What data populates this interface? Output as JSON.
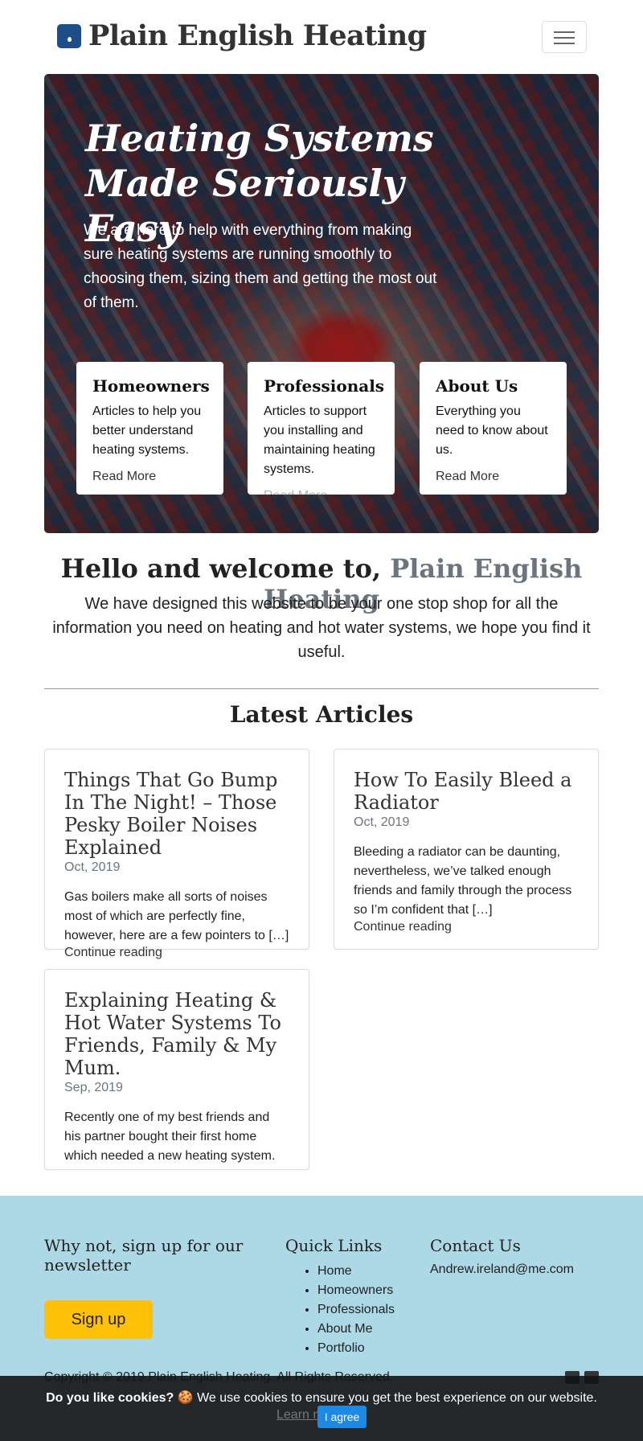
{
  "brand": {
    "name": "Plain English Heating",
    "logo_icon": "water-drop-icon"
  },
  "nav": {
    "menu_icon": "hamburger-icon"
  },
  "hero": {
    "title": "Heating Systems Made Seriously Easy",
    "subtitle": "We are here to help with everything from making sure heating systems are running smoothly to choosing them, sizing them and getting the most out of them.",
    "cards": [
      {
        "title": "Homeowners",
        "text": "Articles to help you better understand heating systems.",
        "link": "Read More"
      },
      {
        "title": "Professionals",
        "text": "Articles to support you installing and maintaining heating systems.",
        "link": "Read More"
      },
      {
        "title": "About Us",
        "text": "Everything you need to know about us.",
        "link": "Read More"
      }
    ]
  },
  "welcome": {
    "title_prefix": "Hello and welcome to,",
    "title_accent": "Plain English Heating",
    "text": "We have designed this website to be your one stop shop for all the information you need on heating and hot water systems, we hope you find it useful."
  },
  "latest": {
    "title": "Latest Articles",
    "articles": [
      {
        "title": "Things That Go Bump In The Night! – Those Pesky Boiler Noises Explained",
        "date": "Oct, 2019",
        "excerpt": "Gas boilers make all sorts of noises most of which are perfectly fine, however, here are a few pointers to […]",
        "link": "Continue reading"
      },
      {
        "title": "How To Easily Bleed a Radiator",
        "date": "Oct, 2019",
        "excerpt": "Bleeding a radiator can be daunting, nevertheless, we’ve talked enough friends and family through the process so I’m confident that […]",
        "link": "Continue reading"
      },
      {
        "title": "Explaining Heating & Hot Water Systems To Friends, Family & My Mum.",
        "date": "Sep, 2019",
        "excerpt": "Recently one of my best friends and his partner bought their first home which needed a new heating system.",
        "link": ""
      }
    ]
  },
  "footer": {
    "newsletter_text": "Why not, sign up for our newsletter",
    "signup_label": "Sign up",
    "quick_links_title": "Quick Links",
    "quick_links": [
      "Home",
      "Homeowners",
      "Professionals",
      "About Me",
      "Portfolio"
    ],
    "contact_title": "Contact Us",
    "contact_email": "Andrew.ireland@me.com",
    "copyright": "Copyright © 2019 Plain English Heating. All Rights Reserved.",
    "social_icons": [
      "linkedin-icon",
      "twitter-icon"
    ]
  },
  "cookie": {
    "question": "Do you like cookies?",
    "emoji": "🍪",
    "message": "We use cookies to ensure you get the best experience on our website.",
    "learn_more": "Learn more",
    "accept_label": "I agree"
  },
  "colors": {
    "brand": "#1d4e89",
    "footer_bg": "#add8e6",
    "signup_bg": "#ffc107",
    "cookie_btn": "#1e88e5"
  }
}
